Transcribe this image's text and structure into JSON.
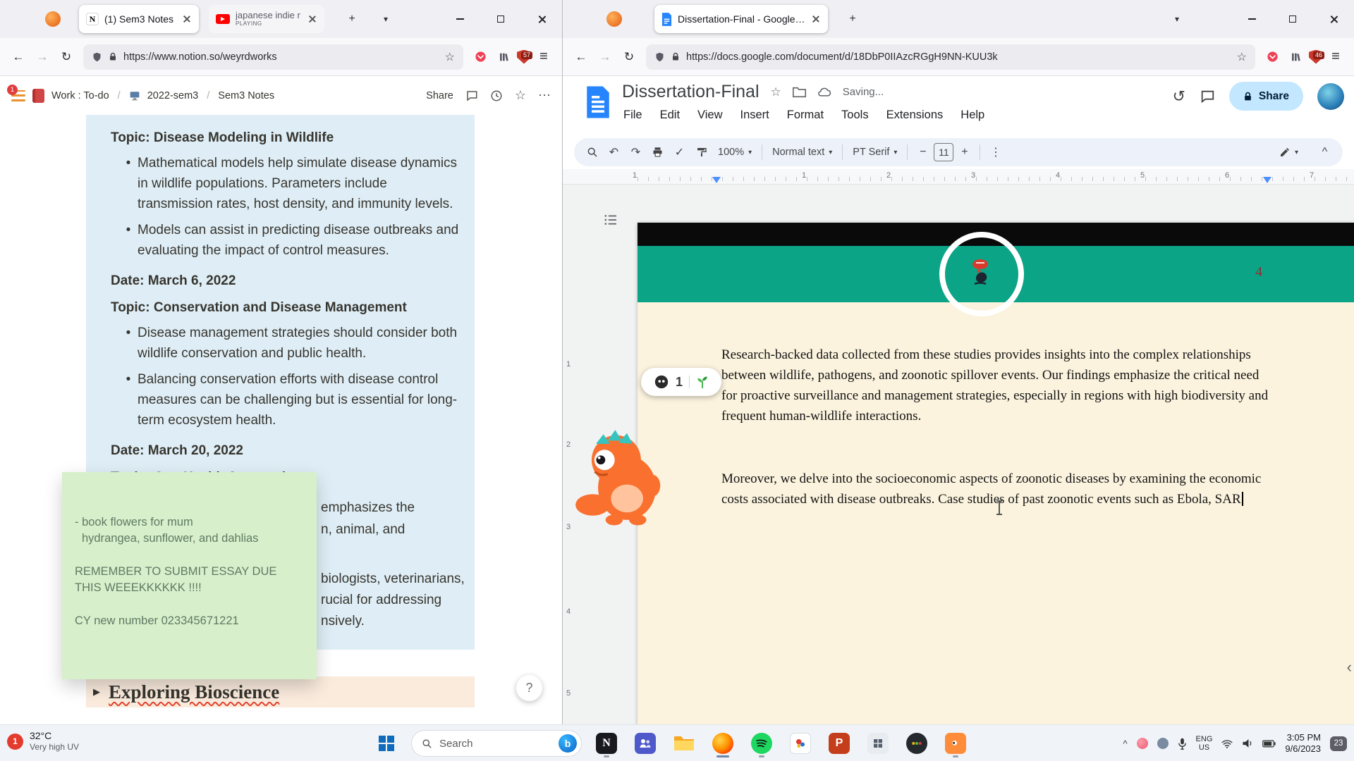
{
  "icons": {
    "plus": "+",
    "chevron_down": "▾",
    "chevron_up": "^",
    "back": "←",
    "forward": "→",
    "refresh": "↻",
    "history": "↺",
    "star": "☆",
    "menu": "≡",
    "ellipsis": "⋯",
    "more_vertical": "⋮",
    "undo": "↶",
    "redo": "↷",
    "check": "✓",
    "bullet": "•",
    "toggle_arrow": "▶",
    "caret_left": "‹",
    "minus": "−",
    "slash": "/"
  },
  "glyphs": {
    "notion": "N",
    "powerpoint": "P",
    "bing": "b"
  },
  "left_window": {
    "tabs": {
      "tab1": "(1) Sem3 Notes",
      "tab2_title": "japanese indie r",
      "tab2_status": "PLAYING"
    },
    "url": "https://www.notion.so/weyrdworks",
    "ublock_badge": "57",
    "notion": {
      "sidebar_badge": "1",
      "breadcrumb": {
        "item1": "Work : To-do",
        "item2": "2022-sem3",
        "item3": "Sem3 Notes"
      },
      "share_label": "Share",
      "content": {
        "topic1": "Topic: Disease Modeling in Wildlife",
        "topic1_bullet1": "Mathematical models help simulate disease dynamics in wildlife populations. Parameters include transmission rates, host density, and immunity levels.",
        "topic1_bullet2": "Models can assist in predicting disease outbreaks and evaluating the impact of control measures.",
        "date1": "Date: March 6, 2022",
        "topic2": "Topic: Conservation and Disease Management",
        "topic2_bullet1": "Disease management strategies should consider both wildlife conservation and public health.",
        "topic2_bullet2": "Balancing conservation efforts with disease control measures can be challenging but is essential for long-term ecosystem health.",
        "date2": "Date: March 20, 2022",
        "topic3": "Topic: One Health Approach",
        "fragment1": "emphasizes the",
        "fragment2": "n, animal, and",
        "fragment3": "biologists, veterinarians,",
        "fragment4": "rucial for addressing",
        "fragment5": "nsively."
      },
      "sticky_note": {
        "line1": "- book flowers for mum",
        "line2": "hydrangea, sunflower, and dahlias",
        "line3": "REMEMBER TO SUBMIT ESSAY DUE THIS WEEEKKKKKK !!!!",
        "line4": "CY new number 023345671221"
      },
      "toggle_heading": "Exploring Bioscience",
      "help_label": "?"
    }
  },
  "right_window": {
    "tabs": {
      "tab1": "Dissertation-Final - Google Doc"
    },
    "url": "https://docs.google.com/document/d/18DbP0IIAzcRGgH9NN-KUU3k",
    "ublock_badge": "46",
    "docs": {
      "title": "Dissertation-Final",
      "saving_status": "Saving...",
      "menu": {
        "file": "File",
        "edit": "Edit",
        "view": "View",
        "insert": "Insert",
        "format": "Format",
        "tools": "Tools",
        "extensions": "Extensions",
        "help": "Help"
      },
      "toolbar": {
        "zoom": "100%",
        "paragraph_style": "Normal text",
        "font": "PT Serif",
        "font_size": "11"
      },
      "share_label": "Share",
      "ruler_h": [
        "1",
        "1",
        "2",
        "3",
        "4",
        "5",
        "6",
        "7"
      ],
      "ruler_v": [
        "1",
        "2",
        "3",
        "4",
        "5"
      ],
      "page": {
        "number": "4",
        "paragraph1": "Research-backed data collected from these studies provides insights into the complex relationships between wildlife, pathogens, and zoonotic spillover events. Our findings emphasize the critical need for proactive surveillance and management strategies, especially in regions with high biodiversity and frequent human-wildlife interactions.",
        "paragraph2": "Moreover, we delve into the socioeconomic aspects of zoonotic diseases by examining the economic costs associated with disease outbreaks. Case studies of past zoonotic events such as Ebola, SAR"
      },
      "pet_badge_count": "1"
    }
  },
  "taskbar": {
    "weather": {
      "badge": "1",
      "temp": "32°C",
      "condition": "Very high UV"
    },
    "search_label": "Search",
    "tray": {
      "lang_line1": "ENG",
      "lang_line2": "US",
      "time": "3:05 PM",
      "date": "9/6/2023",
      "notification_count": "23"
    }
  }
}
